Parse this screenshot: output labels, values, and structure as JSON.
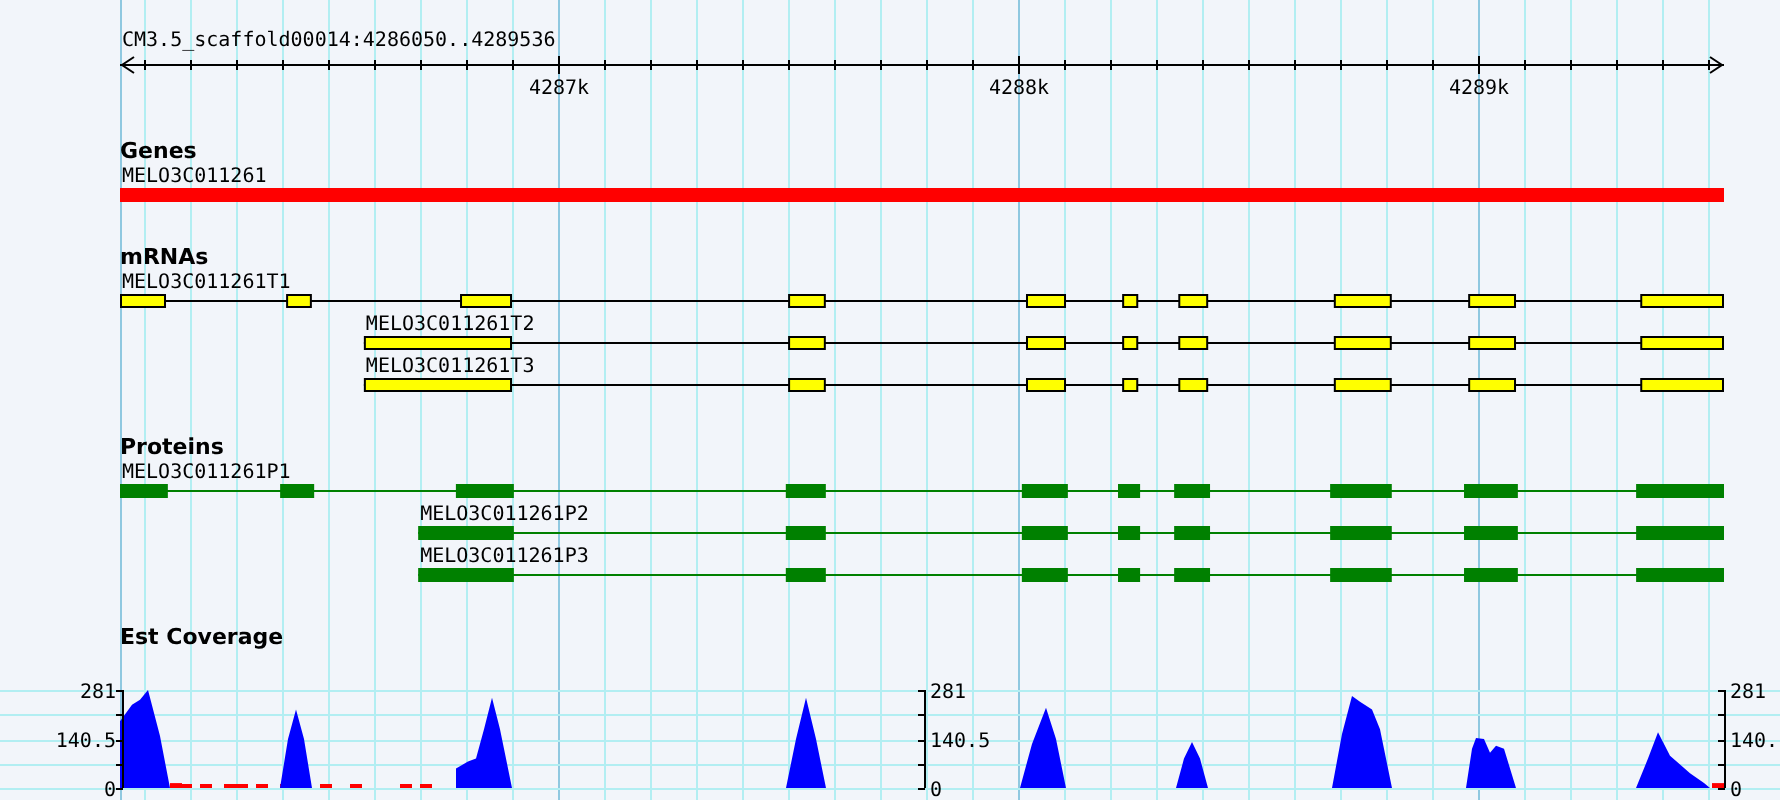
{
  "region": {
    "title": "CM3.5_scaffold00014:4286050..4289536",
    "labels": [
      "4287k",
      "4288k",
      "4289k"
    ]
  },
  "tracks": [
    {
      "kind": "gene",
      "title": "Genes",
      "features": [
        {
          "label": "MELO3C011261"
        }
      ]
    },
    {
      "kind": "mrna",
      "title": "mRNAs",
      "features": [
        {
          "label": "MELO3C011261T1"
        },
        {
          "label": "MELO3C011261T2"
        },
        {
          "label": "MELO3C011261T3"
        }
      ]
    },
    {
      "kind": "protein",
      "title": "Proteins",
      "features": [
        {
          "label": "MELO3C011261P1"
        },
        {
          "label": "MELO3C011261P2"
        },
        {
          "label": "MELO3C011261P3"
        }
      ]
    },
    {
      "kind": "coverage",
      "title": "Est Coverage",
      "axes": [
        [
          "281",
          "140.5",
          "0"
        ],
        [
          "281",
          "140.5",
          "0"
        ],
        [
          "281",
          "140.",
          "0"
        ]
      ]
    }
  ]
}
